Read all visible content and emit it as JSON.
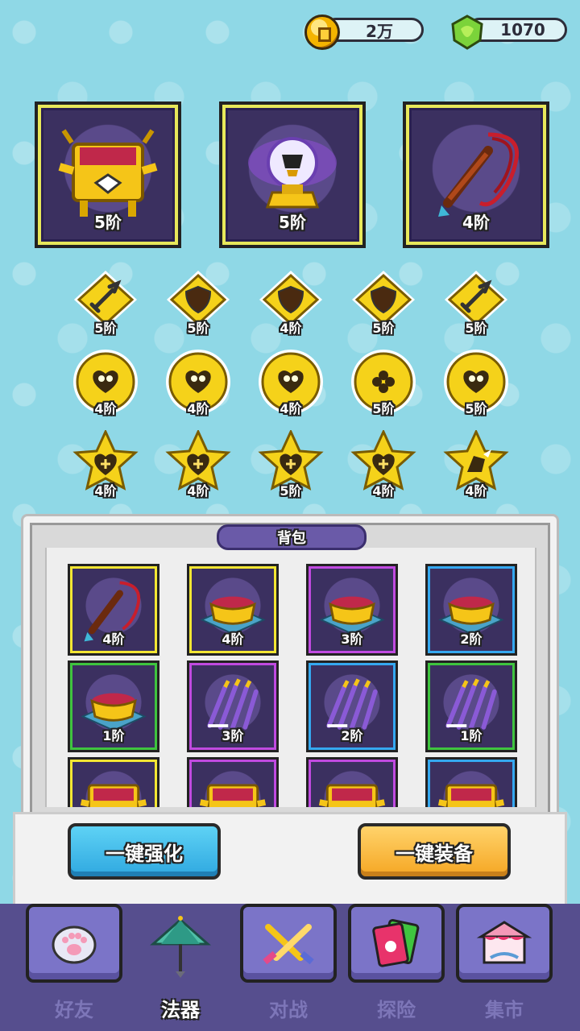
{
  "currency": {
    "coins": "2万",
    "gems": "1070"
  },
  "equipped": [
    {
      "name": "golden-cauldron",
      "level": "5阶",
      "border": "#f3e633"
    },
    {
      "name": "trophy-orb",
      "level": "5阶",
      "border": "#f3e633"
    },
    {
      "name": "whip",
      "level": "4阶",
      "border": "#f3e633"
    }
  ],
  "gem_rows": [
    [
      {
        "icon": "sword-icon",
        "level": "5阶"
      },
      {
        "icon": "shield-icon",
        "level": "5阶"
      },
      {
        "icon": "shield-icon",
        "level": "4阶"
      },
      {
        "icon": "shield-icon",
        "level": "5阶"
      },
      {
        "icon": "sword-icon",
        "level": "5阶"
      }
    ],
    [
      {
        "icon": "heart-eyes-icon",
        "level": "4阶"
      },
      {
        "icon": "heart-eyes-icon",
        "level": "4阶"
      },
      {
        "icon": "heart-eyes-icon",
        "level": "4阶"
      },
      {
        "icon": "clover-icon",
        "level": "5阶"
      },
      {
        "icon": "heart-eyes-icon",
        "level": "5阶"
      }
    ],
    [
      {
        "icon": "heart-plus-icon",
        "level": "4阶"
      },
      {
        "icon": "heart-plus-icon",
        "level": "4阶"
      },
      {
        "icon": "heart-plus-icon",
        "level": "5阶"
      },
      {
        "icon": "heart-plus-icon",
        "level": "4阶"
      },
      {
        "icon": "boot-wing-icon",
        "level": "4阶"
      }
    ]
  ],
  "backpack": {
    "title": "背包",
    "items": [
      {
        "name": "whip",
        "level": "4阶",
        "border": "#f3e633"
      },
      {
        "name": "golden-bowl",
        "level": "4阶",
        "border": "#f3e633"
      },
      {
        "name": "golden-bowl",
        "level": "3阶",
        "border": "#c04ae0"
      },
      {
        "name": "golden-bowl",
        "level": "2阶",
        "border": "#35a8f0"
      },
      {
        "name": "golden-bowl",
        "level": "1阶",
        "border": "#3fc43f"
      },
      {
        "name": "flying-swords",
        "level": "3阶",
        "border": "#c04ae0"
      },
      {
        "name": "flying-swords",
        "level": "2阶",
        "border": "#35a8f0"
      },
      {
        "name": "flying-swords",
        "level": "1阶",
        "border": "#3fc43f"
      },
      {
        "name": "golden-cauldron",
        "level": "",
        "border": "#f3e633"
      },
      {
        "name": "golden-cauldron",
        "level": "",
        "border": "#c04ae0"
      },
      {
        "name": "golden-cauldron",
        "level": "",
        "border": "#c04ae0"
      },
      {
        "name": "golden-cauldron",
        "level": "",
        "border": "#35a8f0"
      }
    ]
  },
  "actions": {
    "enhance_all": "一键强化",
    "equip_all": "一键装备"
  },
  "nav": [
    {
      "label": "好友",
      "icon": "paw-icon"
    },
    {
      "label": "法器",
      "icon": "umbrella-icon",
      "active": true
    },
    {
      "label": "对战",
      "icon": "crossed-swords-icon"
    },
    {
      "label": "探险",
      "icon": "cards-icon"
    },
    {
      "label": "集市",
      "icon": "market-tent-icon"
    }
  ]
}
